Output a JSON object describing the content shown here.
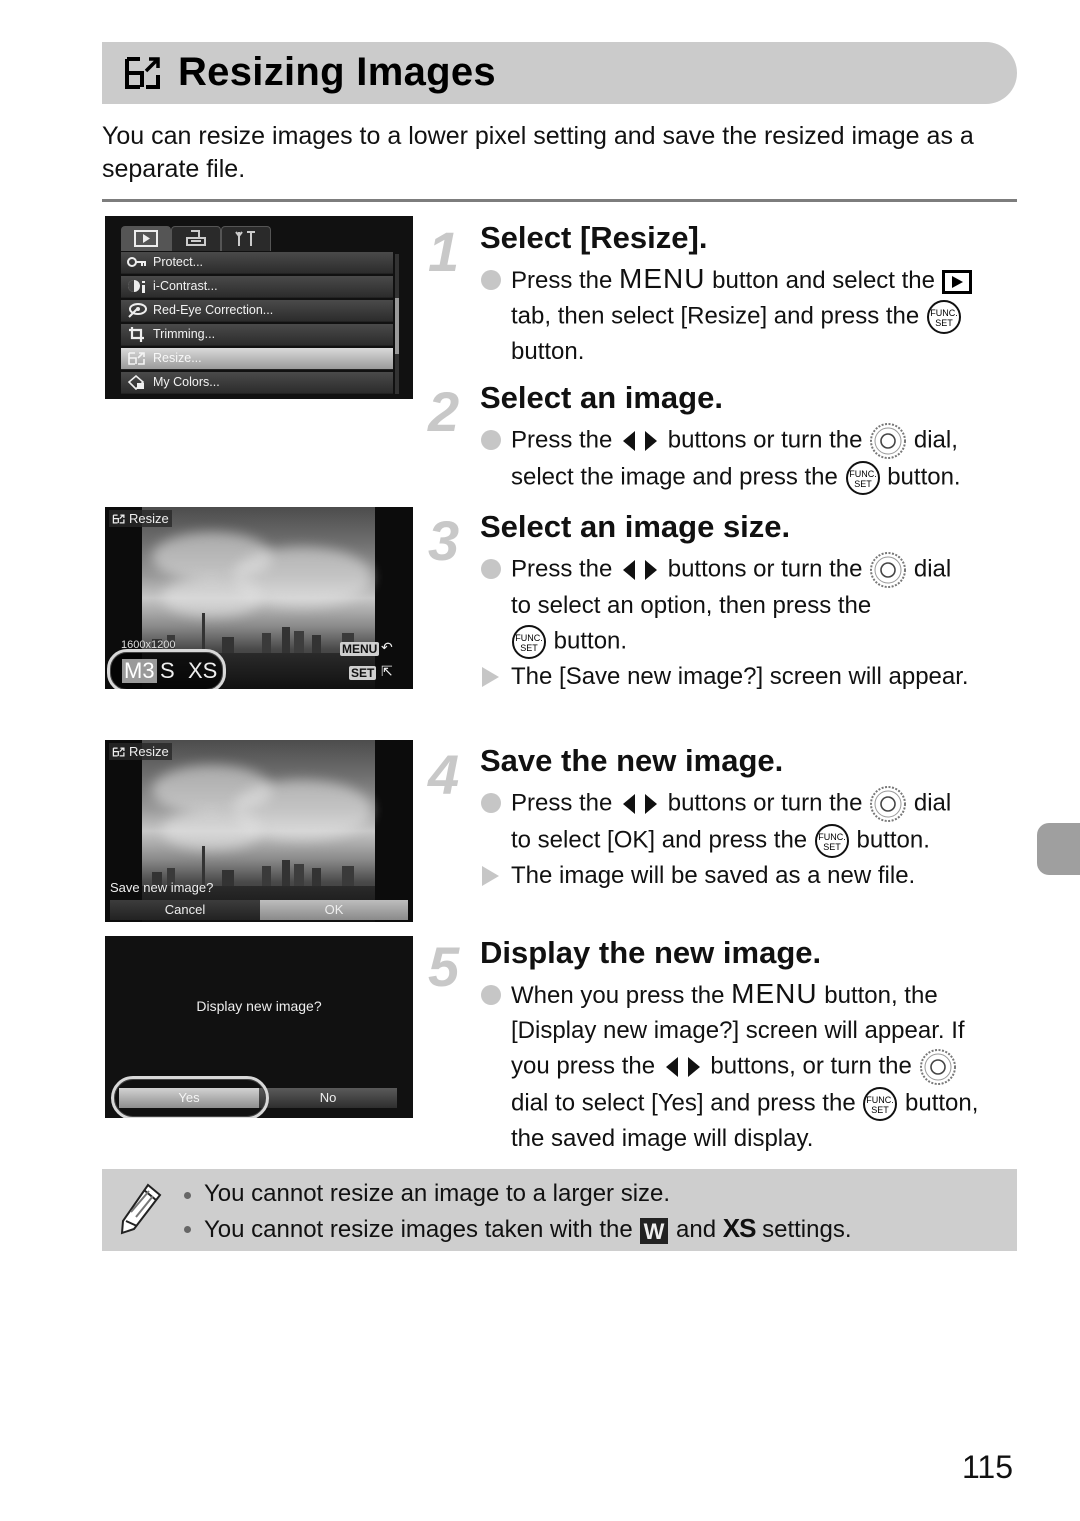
{
  "page": {
    "title": "Resizing Images",
    "title_icon": "resize-icon",
    "intro": "You can resize images to a lower pixel setting and save the resized image as a separate file.",
    "page_number": "115"
  },
  "screens": {
    "menu": {
      "tabs": [
        {
          "icon": "playback-icon",
          "active": true
        },
        {
          "icon": "print-icon",
          "active": false
        },
        {
          "icon": "settings-icon",
          "active": false
        }
      ],
      "items": [
        {
          "icon": "key-icon",
          "label": "Protect..."
        },
        {
          "icon": "i-contrast-icon",
          "label": "i-Contrast..."
        },
        {
          "icon": "red-eye-icon",
          "label": "Red-Eye Correction..."
        },
        {
          "icon": "trimming-icon",
          "label": "Trimming..."
        },
        {
          "icon": "resize-icon",
          "label": "Resize...",
          "selected": true
        },
        {
          "icon": "my-colors-icon",
          "label": "My Colors..."
        }
      ]
    },
    "resize": {
      "label": "Resize",
      "resolution": "1600x1200",
      "options": [
        "M3",
        "S",
        "XS"
      ],
      "selected_option": "M3",
      "menu_key": "MENU",
      "set_key": "SET"
    },
    "save": {
      "label": "Resize",
      "prompt": "Save new image?",
      "cancel": "Cancel",
      "ok": "OK"
    },
    "display": {
      "prompt": "Display new image?",
      "yes": "Yes",
      "no": "No"
    }
  },
  "steps": [
    {
      "number": "1",
      "title": "Select [Resize].",
      "lines": {
        "b1_a": "Press the ",
        "b1_menu": "MENU",
        "b1_b": " button and select the ",
        "b1_c": "tab, then select [Resize] and press the ",
        "b1_d": "button."
      }
    },
    {
      "number": "2",
      "title": "Select an image.",
      "lines": {
        "b1_a": "Press the ",
        "b1_b": " buttons or turn the ",
        "b1_c": " dial,",
        "b1_d": "select the image and press the ",
        "b1_e": " button."
      }
    },
    {
      "number": "3",
      "title": "Select an image size.",
      "lines": {
        "b1_a": "Press the ",
        "b1_b": " buttons or turn the ",
        "b1_c": " dial",
        "b1_d": "to select an option, then press the",
        "b1_e": " button.",
        "r1": "The [Save new image?] screen will appear."
      }
    },
    {
      "number": "4",
      "title": "Save the new image.",
      "lines": {
        "b1_a": "Press the ",
        "b1_b": " buttons or turn the ",
        "b1_c": " dial",
        "b1_d": "to select [OK] and press the ",
        "b1_e": " button.",
        "r1": "The image will be saved as a new file."
      }
    },
    {
      "number": "5",
      "title": "Display the new image.",
      "lines": {
        "b1_a": "When you press the ",
        "b1_menu": "MENU",
        "b1_b": " button, the [Display new image?] screen will appear. If you press the ",
        "b1_c": " buttons, or turn the ",
        "b1_d": " dial to select [Yes] and press the ",
        "b1_e": " button, the saved image will display."
      }
    }
  ],
  "note": {
    "icon": "pencil-icon",
    "items": [
      "You cannot resize an image to a larger size.",
      {
        "a": "You cannot resize images taken with the ",
        "w_icon": "W",
        "b": " and ",
        "xs_icon": "XS",
        "c": " settings."
      }
    ]
  },
  "colors": {
    "title_bar": "#cbcbcb",
    "note_bg": "#cecece",
    "step_number": "#c8c8c8",
    "side_tab": "#9f9f9f"
  }
}
